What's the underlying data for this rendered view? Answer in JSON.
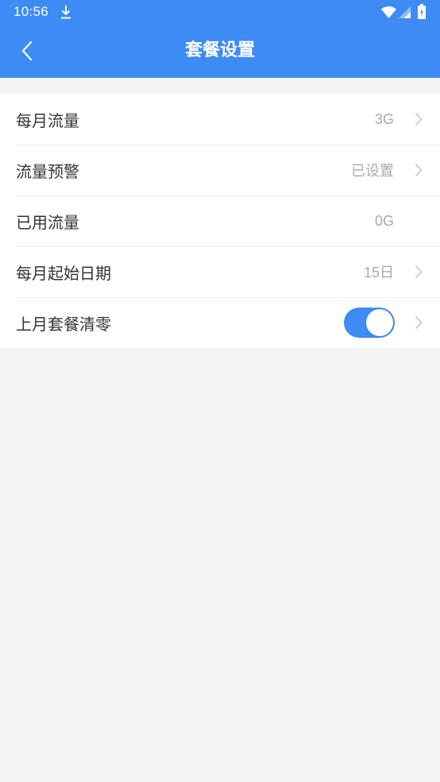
{
  "colors": {
    "accent": "#3e8bf6",
    "background": "#f4f4f4"
  },
  "status_bar": {
    "time": "10:56",
    "icons": [
      "download-icon",
      "wifi-icon",
      "signal-icon",
      "battery-icon"
    ]
  },
  "header": {
    "title": "套餐设置",
    "back_icon": "chevron-left-icon"
  },
  "settings": [
    {
      "label": "每月流量",
      "value": "3G"
    },
    {
      "label": "流量预警",
      "value": "已设置"
    },
    {
      "label": "已用流量",
      "value": "0G"
    },
    {
      "label": "每月起始日期",
      "value": "15日"
    },
    {
      "label": "上月套餐清零",
      "toggle_on": true
    }
  ]
}
